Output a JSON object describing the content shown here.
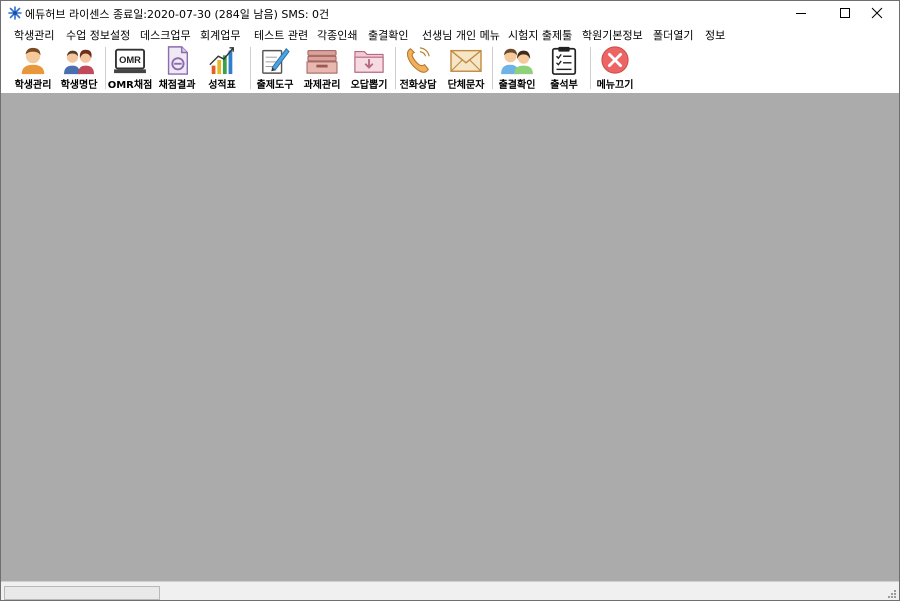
{
  "window": {
    "title": "에듀허브  라이센스 종료일:2020-07-30 (284일 남음) SMS: 0건"
  },
  "menu": [
    {
      "label": "학생관리"
    },
    {
      "label": "수업 정보설정"
    },
    {
      "label": "데스크업무"
    },
    {
      "label": "회계업무"
    },
    {
      "label": "테스트 관련"
    },
    {
      "label": "각종인쇄"
    },
    {
      "label": "출결확인"
    },
    {
      "label": "선생님 개인 메뉴"
    },
    {
      "label": "시험지 출제툴"
    },
    {
      "label": "학원기본정보"
    },
    {
      "label": "폴더열기"
    },
    {
      "label": "정보"
    }
  ],
  "toolbar": [
    {
      "label": "학생관리",
      "icon": "student-icon"
    },
    {
      "label": "학생명단",
      "icon": "students-list-icon"
    },
    {
      "label": "OMR채점",
      "icon": "omr-icon"
    },
    {
      "label": "채점결과",
      "icon": "grading-result-icon"
    },
    {
      "label": "성적표",
      "icon": "report-card-icon"
    },
    {
      "label": "출제도구",
      "icon": "exam-tool-icon"
    },
    {
      "label": "과제관리",
      "icon": "homework-icon"
    },
    {
      "label": "오답뽑기",
      "icon": "wrong-answer-icon"
    },
    {
      "label": "전화상담",
      "icon": "phone-icon"
    },
    {
      "label": "단체문자",
      "icon": "mail-icon"
    },
    {
      "label": "출결확인",
      "icon": "attendance-check-icon"
    },
    {
      "label": "출석부",
      "icon": "attendance-book-icon"
    },
    {
      "label": "메뉴끄기",
      "icon": "close-menu-icon"
    }
  ],
  "omr_icon_text": "OMR",
  "colors": {
    "workspace": "#ababab",
    "close_menu": "#ec6464"
  }
}
